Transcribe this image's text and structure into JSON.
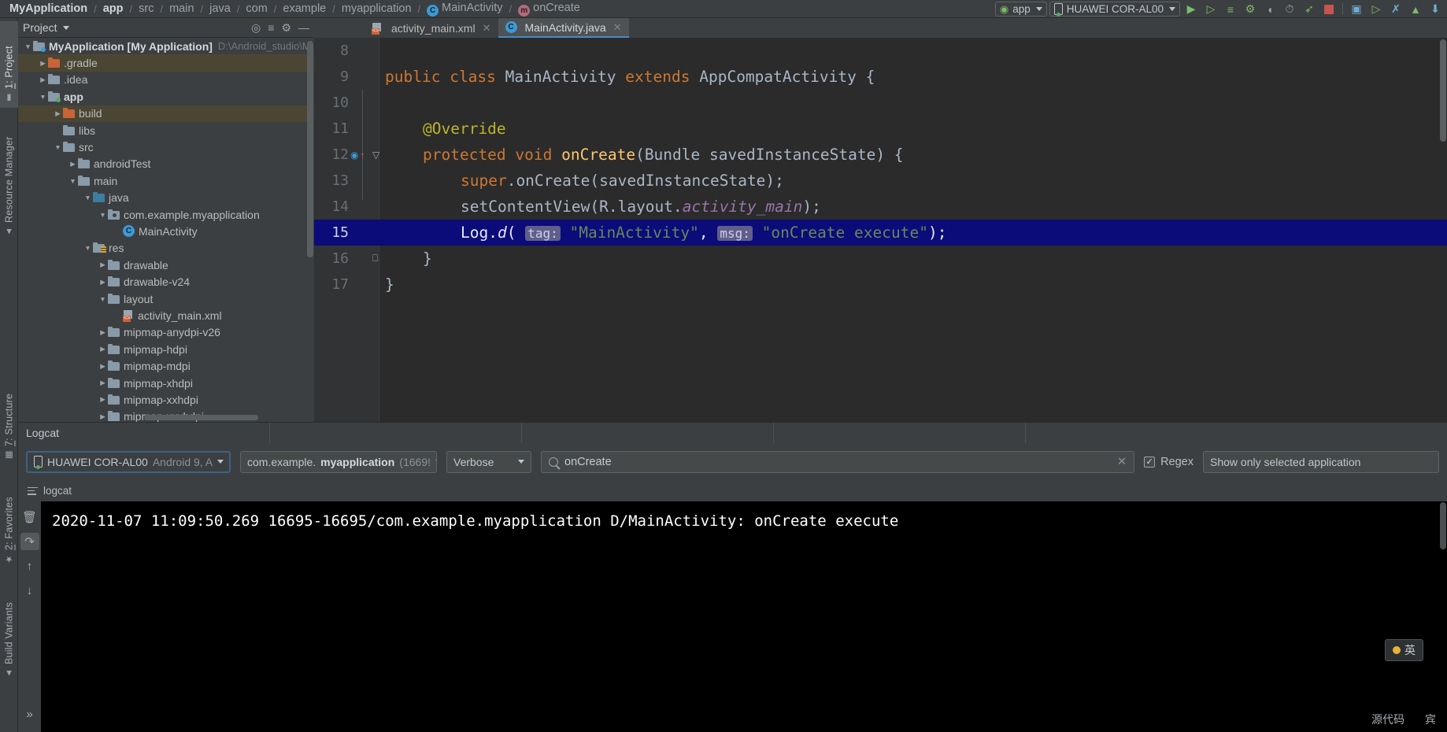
{
  "breadcrumb": {
    "items": [
      {
        "label": "MyApplication",
        "style": "bold"
      },
      {
        "label": "app",
        "style": "bold"
      },
      {
        "label": "src",
        "style": "dim"
      },
      {
        "label": "main",
        "style": "dim"
      },
      {
        "label": "java",
        "style": "dim"
      },
      {
        "label": "com",
        "style": "dim"
      },
      {
        "label": "example",
        "style": "dim"
      },
      {
        "label": "myapplication",
        "style": "dim"
      },
      {
        "label": "MainActivity",
        "style": "dim",
        "icon": "class-icon",
        "glyph": "C"
      },
      {
        "label": "onCreate",
        "style": "dim",
        "icon": "method-icon",
        "glyph": "m"
      }
    ],
    "separator": "/"
  },
  "toolbar": {
    "run_config": "app",
    "device": "HUAWEI COR-AL00",
    "icons": [
      {
        "name": "run-icon",
        "glyph": "▷"
      },
      {
        "name": "run-with-coverage-icon",
        "glyph": "▷"
      },
      {
        "name": "apply-changes-icon",
        "glyph": "☰"
      },
      {
        "name": "debug-icon",
        "glyph": "⚙"
      },
      {
        "name": "attach-debugger-icon",
        "glyph": "◐"
      },
      {
        "name": "profiler-icon",
        "glyph": "◴"
      },
      {
        "name": "run-anything-icon",
        "glyph": "➦"
      },
      {
        "name": "stop-icon",
        "glyph": ""
      },
      {
        "name": "avd-manager-icon",
        "glyph": "▣"
      },
      {
        "name": "sdk-manager-icon",
        "glyph": "▶"
      },
      {
        "name": "layout-inspector-icon",
        "glyph": "✇"
      },
      {
        "name": "device-file-explorer-icon",
        "glyph": "▲"
      },
      {
        "name": "search-everywhere-icon",
        "glyph": "⬇"
      }
    ]
  },
  "left_tool_tabs": [
    {
      "name": "project",
      "label_pre": "1",
      "label": ": Project",
      "icon": "folder-icon",
      "active": true
    },
    {
      "name": "resource-manager",
      "label_pre": "",
      "label": "Resource Manager",
      "icon": "resource-icon",
      "active": false
    },
    {
      "name": "structure",
      "label_pre": "7",
      "label": ": Structure",
      "icon": "structure-icon",
      "active": false
    },
    {
      "name": "favorites",
      "label_pre": "2",
      "label": ": Favorites",
      "icon": "star-icon",
      "active": false
    },
    {
      "name": "build-variants",
      "label_pre": "",
      "label": "Build Variants",
      "icon": "android-icon",
      "active": false
    }
  ],
  "project_panel": {
    "title": "Project",
    "header_icons": [
      "target-icon",
      "collapse-all-icon",
      "settings-icon",
      "hide-icon"
    ],
    "tree": [
      {
        "depth": 0,
        "arrow": "down",
        "icon": "module-folder",
        "label": "MyApplication [My Application]",
        "bold": true,
        "path": "D:\\Android_studio\\M",
        "badge": "cyan"
      },
      {
        "depth": 1,
        "arrow": "right",
        "icon": "folder-orange",
        "label": ".gradle",
        "excluded": true
      },
      {
        "depth": 1,
        "arrow": "right",
        "icon": "folder",
        "label": ".idea"
      },
      {
        "depth": 1,
        "arrow": "down",
        "icon": "folder",
        "label": "app",
        "bold": true,
        "badge": "green"
      },
      {
        "depth": 2,
        "arrow": "right",
        "icon": "folder-orange",
        "label": "build",
        "excluded": true
      },
      {
        "depth": 2,
        "arrow": "none",
        "icon": "folder",
        "label": "libs"
      },
      {
        "depth": 2,
        "arrow": "down",
        "icon": "folder",
        "label": "src"
      },
      {
        "depth": 3,
        "arrow": "right",
        "icon": "folder",
        "label": "androidTest"
      },
      {
        "depth": 3,
        "arrow": "down",
        "icon": "folder",
        "label": "main"
      },
      {
        "depth": 4,
        "arrow": "down",
        "icon": "folder-blue",
        "label": "java"
      },
      {
        "depth": 5,
        "arrow": "down",
        "icon": "package",
        "label": "com.example.myapplication"
      },
      {
        "depth": 6,
        "arrow": "none",
        "icon": "class",
        "label": "MainActivity"
      },
      {
        "depth": 4,
        "arrow": "down",
        "icon": "folder-res",
        "label": "res"
      },
      {
        "depth": 5,
        "arrow": "right",
        "icon": "folder",
        "label": "drawable"
      },
      {
        "depth": 5,
        "arrow": "right",
        "icon": "folder",
        "label": "drawable-v24"
      },
      {
        "depth": 5,
        "arrow": "down",
        "icon": "folder",
        "label": "layout"
      },
      {
        "depth": 6,
        "arrow": "none",
        "icon": "xml",
        "label": "activity_main.xml"
      },
      {
        "depth": 5,
        "arrow": "right",
        "icon": "folder",
        "label": "mipmap-anydpi-v26"
      },
      {
        "depth": 5,
        "arrow": "right",
        "icon": "folder",
        "label": "mipmap-hdpi"
      },
      {
        "depth": 5,
        "arrow": "right",
        "icon": "folder",
        "label": "mipmap-mdpi"
      },
      {
        "depth": 5,
        "arrow": "right",
        "icon": "folder",
        "label": "mipmap-xhdpi"
      },
      {
        "depth": 5,
        "arrow": "right",
        "icon": "folder",
        "label": "mipmap-xxhdpi"
      },
      {
        "depth": 5,
        "arrow": "right",
        "icon": "folder",
        "label": "mipmap-xxxhdpi"
      }
    ]
  },
  "editor": {
    "tabs": [
      {
        "name": "activity_main.xml",
        "label": "activity_main.xml",
        "icon": "xml-icon",
        "active": false,
        "closable": true
      },
      {
        "name": "MainActivity.java",
        "label": "MainActivity.java",
        "icon": "class-icon",
        "active": true,
        "closable": true
      }
    ],
    "lines": [
      {
        "no": "8",
        "content": ""
      },
      {
        "no": "9",
        "content": "public class MainActivity extends AppCompatActivity {"
      },
      {
        "no": "10",
        "content": ""
      },
      {
        "no": "11",
        "content": "    @Override"
      },
      {
        "no": "12",
        "content": "    protected void onCreate(Bundle savedInstanceState) {",
        "gutter_icons": [
          "override-marker",
          "fold-marker"
        ]
      },
      {
        "no": "13",
        "content": "        super.onCreate(savedInstanceState);"
      },
      {
        "no": "14",
        "content": "        setContentView(R.layout.activity_main);"
      },
      {
        "no": "15",
        "content": "        Log.d( tag: \"MainActivity\",  msg: \"onCreate execute\");",
        "highlighted": true
      },
      {
        "no": "16",
        "content": "    }",
        "gutter_icons": [
          "fold-end-marker"
        ]
      },
      {
        "no": "17",
        "content": "}"
      }
    ],
    "inlay_hints": [
      "tag:",
      "msg:"
    ]
  },
  "logcat": {
    "panel_title": "Logcat",
    "device_selector": {
      "name": "HUAWEI COR-AL00",
      "suffix": "Android 9, A"
    },
    "process_selector": {
      "package_prefix": "com.example.",
      "package_bold": "myapplication",
      "pid": "(1669!"
    },
    "level_selector": "Verbose",
    "search_value": "onCreate",
    "search_clear": "×",
    "regex_label": "Regex",
    "regex_checked": true,
    "filter_selector": "Show only selected application",
    "tab_label": "logcat",
    "tools": [
      {
        "name": "clear-logcat-button",
        "glyph": "Ὕ1"
      },
      {
        "name": "scroll-to-end-button",
        "glyph": "↧",
        "active": true
      },
      {
        "name": "up-button",
        "glyph": "↑"
      },
      {
        "name": "down-button",
        "glyph": "↓"
      },
      {
        "name": "expand-button",
        "glyph": "»"
      }
    ],
    "output": "2020-11-07 11:09:50.269 16695-16695/com.example.myapplication D/MainActivity: onCreate execute"
  },
  "floating": {
    "ime_label": "英",
    "status_left": "源代码",
    "status_right": "宾"
  },
  "colors": {
    "panel_bg": "#3C3F41",
    "editor_bg": "#2B2B2B",
    "gutter_bg": "#313335",
    "selection": "#0B0B7A",
    "keyword": "#CC7832",
    "string": "#6A8759",
    "method": "#FFC66D",
    "field": "#9876AA",
    "annotation": "#BBB529",
    "text": "#A9B7C6",
    "accent": "#4A88C7",
    "excluded_row": "#4B4634",
    "console_bg": "#000000"
  }
}
